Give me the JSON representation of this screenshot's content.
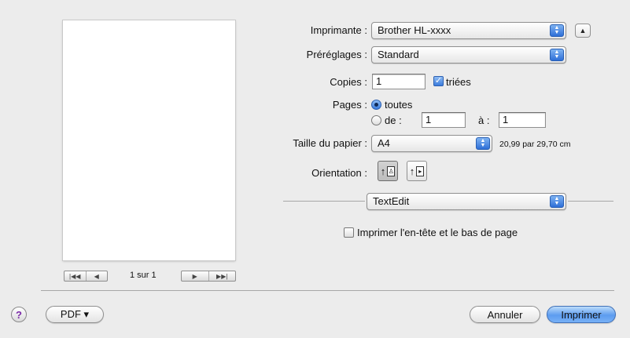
{
  "preview": {
    "nav_first": "|◀◀",
    "nav_prev": "◀",
    "page_indicator": "1 sur 1",
    "nav_next": "▶",
    "nav_last": "▶▶|"
  },
  "printer": {
    "label": "Imprimante :",
    "value": "Brother HL-xxxx",
    "collapse_icon": "▲"
  },
  "presets": {
    "label": "Préréglages :",
    "value": "Standard"
  },
  "copies": {
    "label": "Copies :",
    "value": "1",
    "collated_label": "triées",
    "collated_checked": true
  },
  "pages": {
    "label": "Pages :",
    "all_label": "toutes",
    "range_label": "de :",
    "from": "1",
    "to_label": "à :",
    "to": "1",
    "selected": "all"
  },
  "paper": {
    "label": "Taille du papier :",
    "value": "A4",
    "dimensions": "20,99 par 29,70 cm"
  },
  "orientation": {
    "label": "Orientation :",
    "selected": "portrait"
  },
  "section_popup": {
    "value": "TextEdit"
  },
  "header_footer": {
    "label": "Imprimer l'en-tête et le bas de page",
    "checked": false
  },
  "footer": {
    "help_icon": "?",
    "pdf_label": "PDF ▾",
    "cancel_label": "Annuler",
    "print_label": "Imprimer"
  },
  "colors": {
    "accent": "#3a7bdc",
    "help": "#7b2aa8"
  }
}
